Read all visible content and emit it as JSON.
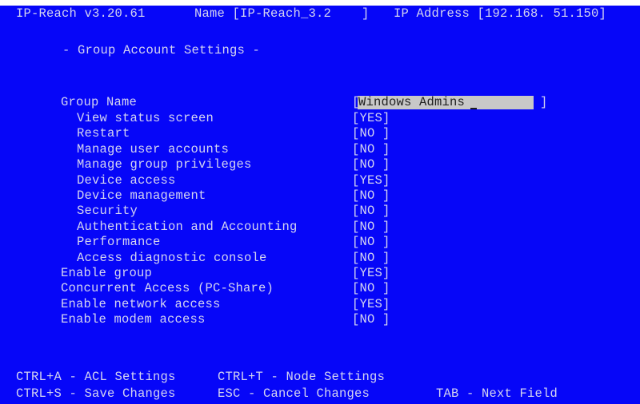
{
  "header": {
    "version": "IP-Reach v3.20.61",
    "name_label": "Name [IP-Reach_3.2    ]",
    "ip_label": "IP Address [192.168. 51.150]"
  },
  "section_title": "- Group Account Settings -",
  "group_name": {
    "label": "Group Name",
    "value": "Windows Admins",
    "open": "[",
    "close": "]"
  },
  "settings": [
    {
      "label": "View status screen",
      "value": "[YES]"
    },
    {
      "label": "Restart",
      "value": "[NO ]"
    },
    {
      "label": "Manage user accounts",
      "value": "[NO ]"
    },
    {
      "label": "Manage group privileges",
      "value": "[NO ]"
    },
    {
      "label": "Device access",
      "value": "[YES]"
    },
    {
      "label": "Device management",
      "value": "[NO ]"
    },
    {
      "label": "Security",
      "value": "[NO ]"
    },
    {
      "label": "Authentication and Accounting",
      "value": "[NO ]"
    },
    {
      "label": "Performance",
      "value": "[NO ]"
    },
    {
      "label": "Access diagnostic console",
      "value": "[NO ]"
    }
  ],
  "options": [
    {
      "label": "Enable group",
      "value": "[YES]"
    },
    {
      "label": "Concurrent Access (PC-Share)",
      "value": "[NO ]"
    },
    {
      "label": "Enable network access",
      "value": "[YES]"
    },
    {
      "label": "Enable modem access",
      "value": "[NO ]"
    }
  ],
  "footer": {
    "acl": "CTRL+A - ACL Settings",
    "node": "CTRL+T - Node Settings",
    "save": "CTRL+S - Save Changes",
    "cancel": "ESC - Cancel Changes",
    "next": "TAB - Next Field"
  }
}
